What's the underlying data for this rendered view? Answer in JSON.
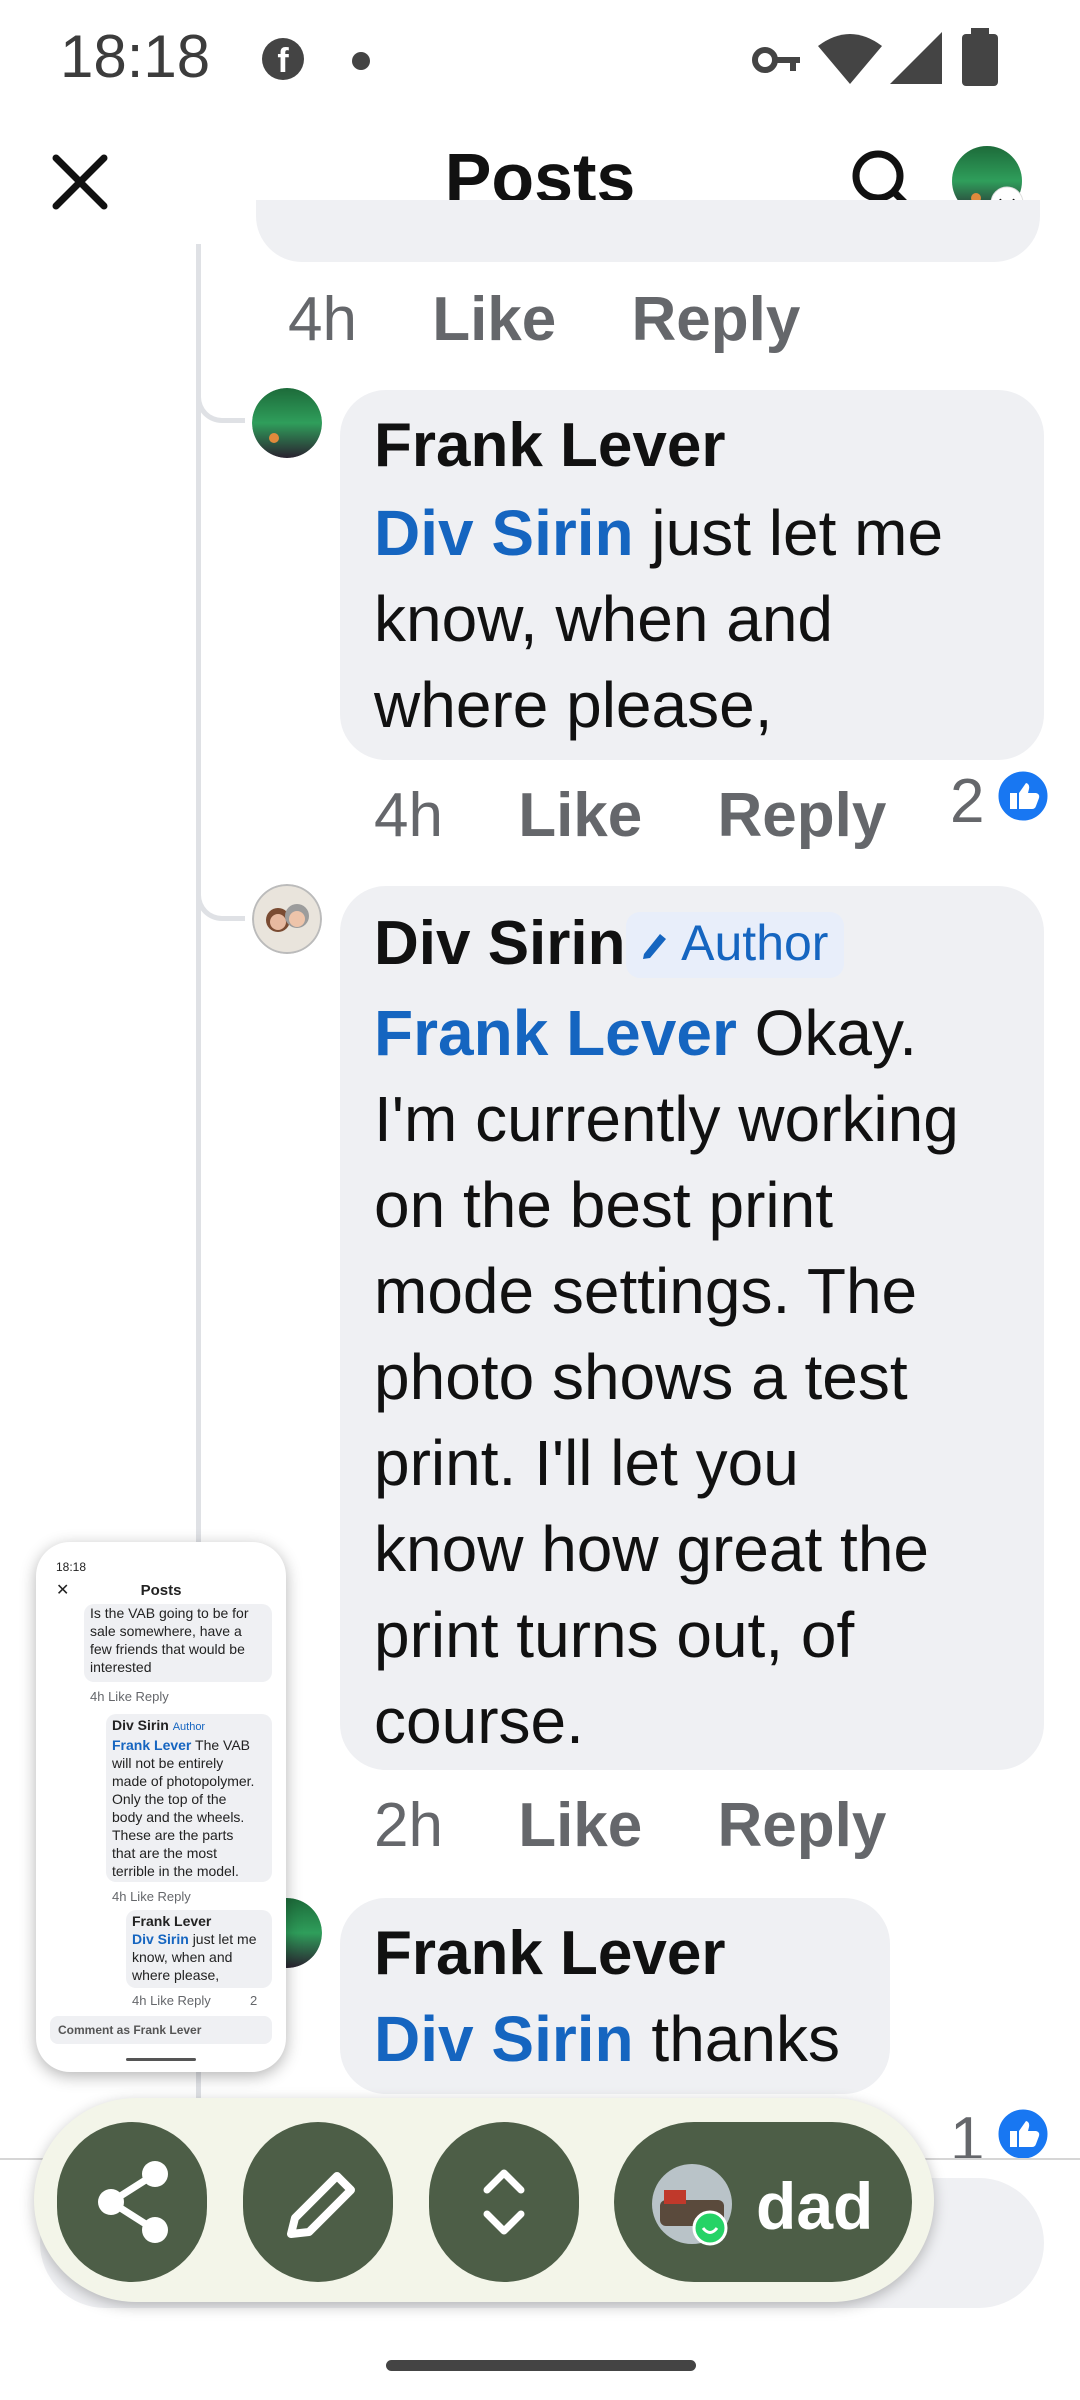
{
  "status_bar": {
    "time": "18:18"
  },
  "header": {
    "title": "Posts"
  },
  "colors": {
    "accent": "#1565c0",
    "fab": "#4d5e47",
    "bubble": "#eff0f3"
  },
  "comments": [
    {
      "time": "4h",
      "like": "Like",
      "reply": "Reply"
    },
    {
      "author": "Frank Lever",
      "mention": "Div Sirin",
      "text_lines": [
        "just let me",
        "know, when and",
        "where please,"
      ],
      "time": "4h",
      "like": "Like",
      "reply": "Reply",
      "reactions": "2"
    },
    {
      "author": "Div Sirin",
      "badge": "Author",
      "mention": "Frank Lever",
      "text_lines": [
        "Okay.",
        "I'm currently working",
        "on the best print",
        "mode settings. The",
        "photo shows a test",
        "print. I'll let you",
        "know how great the",
        "print turns out, of",
        "course."
      ],
      "time": "2h",
      "like": "Like",
      "reply": "Reply"
    },
    {
      "author": "Frank Lever",
      "mention": "Div Sirin",
      "text": "thanks",
      "reactions": "1"
    }
  ],
  "bubble_bar": {
    "contact": "dad"
  },
  "thumbnail": {
    "time": "18:18",
    "title": "Posts",
    "c1_lines": [
      "Is the VAB going to be for",
      "sale somewhere, have a",
      "few friends that would be",
      "interested"
    ],
    "c1_meta": "4h   Like   Reply",
    "c2_author": "Div Sirin",
    "c2_badge": "Author",
    "c2_mention": "Frank Lever",
    "c2_lines": [
      "The VAB",
      "will not be entirely",
      "made of photopolymer.",
      "Only the top of the",
      "body and the wheels.",
      "These are the parts",
      "that are the most",
      "terrible in the model."
    ],
    "c2_meta": "4h   Like   Reply",
    "c3_author": "Frank Lever",
    "c3_mention": "Div Sirin",
    "c3_lines": [
      "just let me",
      "know, when and",
      "where please,"
    ],
    "c3_meta": "4h   Like   Reply",
    "c3_count": "2",
    "composer": "Comment as Frank Lever"
  }
}
